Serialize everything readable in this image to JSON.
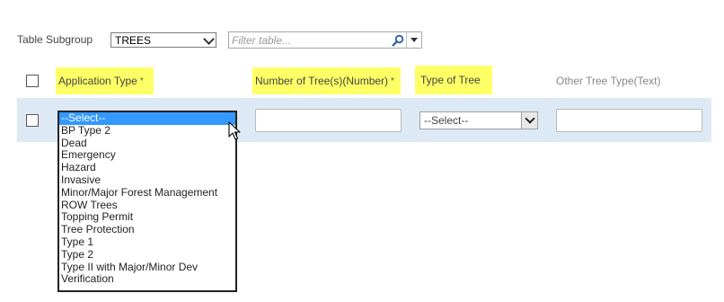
{
  "toolbar": {
    "subgroup_label": "Table Subgroup",
    "subgroup_value": "TREES",
    "filter_placeholder": "Filter table..."
  },
  "table": {
    "columns": [
      {
        "label": "Application Type",
        "required": true,
        "highlighted": true
      },
      {
        "label": "Number of Tree(s)(Number)",
        "required": true,
        "highlighted": true
      },
      {
        "label": "Type of Tree",
        "required": false,
        "highlighted": true
      },
      {
        "label": "Other Tree Type(Text)",
        "required": false,
        "highlighted": false
      }
    ],
    "required_marker": "*",
    "row": {
      "application_type_value": "--Select--",
      "number_of_trees_value": "",
      "type_of_tree_value": "--Select--",
      "other_tree_type_value": ""
    }
  },
  "application_type_options": [
    "--Select--",
    "BP Type 2",
    "Dead",
    "Emergency",
    "Hazard",
    "Invasive",
    "Minor/Major Forest Management",
    "ROW Trees",
    "Topping Permit",
    "Tree Protection",
    "Type 1",
    "Type 2",
    "Type II with Major/Minor Dev",
    "Verification"
  ],
  "colors": {
    "highlight": "#ffff66",
    "row_band": "#dde9f5",
    "selected_option": "#3399ff"
  },
  "icons": {
    "search": "magnifier-icon",
    "dropdown": "chevron-down-icon",
    "cursor": "mouse-pointer-icon"
  }
}
